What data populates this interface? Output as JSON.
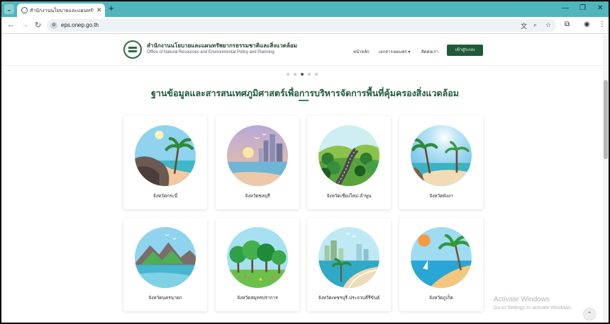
{
  "browser": {
    "tab_title": "สำนักงานนโยบายและแผนทรัพยากร",
    "url": "eps.onep.go.th",
    "tab_menu_icon": "chevron-down-icon",
    "new_tab_symbol": "+",
    "close_symbol": "✕"
  },
  "header": {
    "org_name_th": "สำนักงานนโยบายและแผนทรัพยากรธรรมชาติและสิ่งแวดล้อม",
    "org_name_en": "Office of Natural Resources and Environmental Policy and Planning",
    "nav": [
      {
        "label": "หน้าหลัก"
      },
      {
        "label": "เอกสารเผยแพร่ ▾"
      },
      {
        "label": "ติดต่อเรา"
      }
    ],
    "login_label": "เข้าสู่ระบบ",
    "accent": "#1f5a3a"
  },
  "carousel": {
    "count": 5,
    "active": 3
  },
  "section": {
    "title": "ฐานข้อมูลและสารสนเทศภูมิศาสตร์เพื่อการบริหารจัดการพื้นที่คุ้มครองสิ่งแวดล้อม"
  },
  "cards": [
    {
      "label": "จังหวัดกระบี่",
      "scene": "beach-cliff"
    },
    {
      "label": "จังหวัดชลบุรี",
      "scene": "city-sunset"
    },
    {
      "label": "จังหวัดเชียงใหม่-ลำพูน",
      "scene": "forest-road"
    },
    {
      "label": "จังหวัดพังงา",
      "scene": "palm-beach"
    },
    {
      "label": "จังหวัดนครนายก",
      "scene": "mountain-lake"
    },
    {
      "label": "จังหวัดสมุทรปราการ",
      "scene": "trees-park"
    },
    {
      "label": "จังหวัดเพชรบุรี-ประจวบคีรีขันธ์",
      "scene": "coast-city"
    },
    {
      "label": "จังหวัดภูเก็ต",
      "scene": "sunset-palm"
    }
  ],
  "watermark": {
    "line1": "Activate Windows",
    "line2": "Go to Settings to activate Windows."
  }
}
